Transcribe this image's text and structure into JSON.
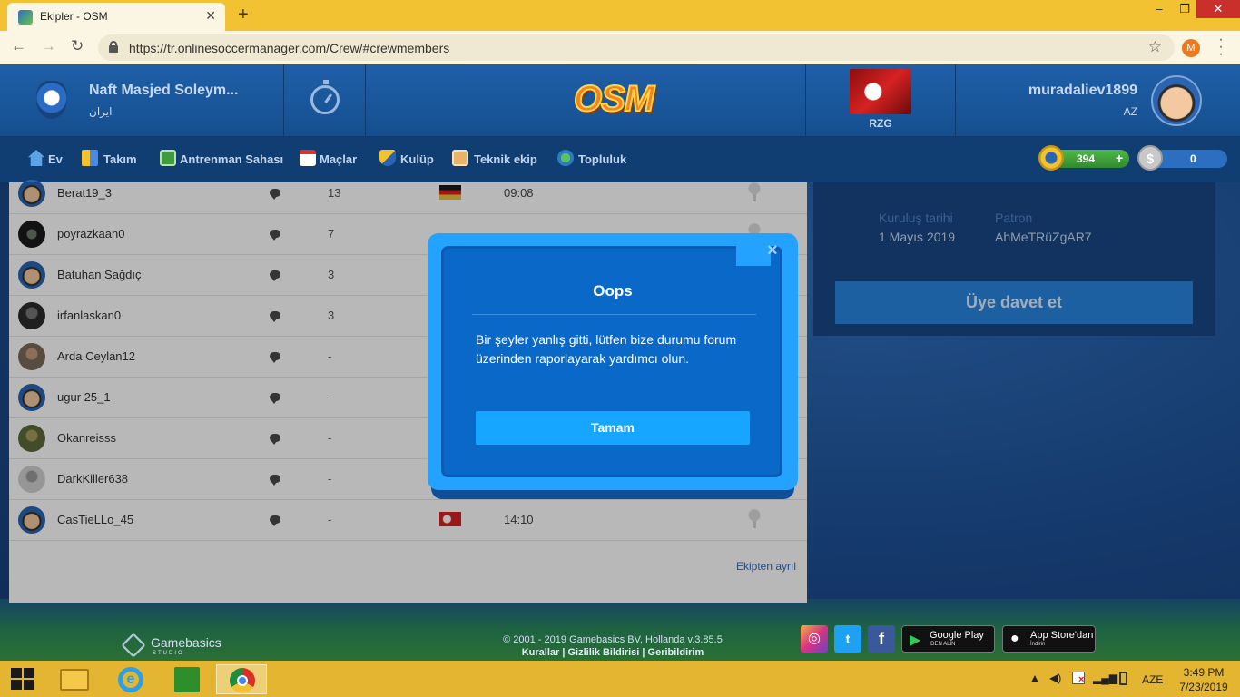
{
  "browser": {
    "tab_title": "Ekipler - OSM",
    "tab_close": "✕",
    "new_tab": "+",
    "url": "https://tr.onlinesoccermanager.com/Crew/#crewmembers",
    "profile_initial": "M",
    "window_min": "–",
    "window_max": "❐",
    "window_close": "✕"
  },
  "header": {
    "club_name": "Naft Masjed Soleym...",
    "club_country": "ایران",
    "logo_text": "OSM",
    "crew_tag": "RZG",
    "manager_name": "muradaliev1899",
    "manager_country": "AZ"
  },
  "nav": {
    "items": [
      "Ev",
      "Takım",
      "Antrenman Sahası",
      "Maçlar",
      "Kulüp",
      "Teknik ekip",
      "Topluluk"
    ],
    "coins": "394",
    "coin_plus": "+",
    "cash": "0",
    "cash_symbol": "$"
  },
  "members": [
    {
      "name": "Berat19_3",
      "count": "13",
      "flag": "de",
      "time": "09:08",
      "avatar": "osm"
    },
    {
      "name": "poyrazkaan0",
      "count": "7",
      "flag": "",
      "time": "",
      "avatar": "dark"
    },
    {
      "name": "Batuhan Sağdıç",
      "count": "3",
      "flag": "",
      "time": "",
      "avatar": "osm"
    },
    {
      "name": "irfanlaskan0",
      "count": "3",
      "flag": "",
      "time": "",
      "avatar": "grey"
    },
    {
      "name": "Arda Ceylan12",
      "count": "-",
      "flag": "",
      "time": "",
      "avatar": "photo"
    },
    {
      "name": "ugur 25_1",
      "count": "-",
      "flag": "",
      "time": "",
      "avatar": "osm"
    },
    {
      "name": "Okanreisss",
      "count": "-",
      "flag": "",
      "time": "",
      "avatar": "green"
    },
    {
      "name": "DarkKiller638",
      "count": "-",
      "flag": "",
      "time": "",
      "avatar": "light"
    },
    {
      "name": "CasTieLLo_45",
      "count": "-",
      "flag": "tr",
      "time": "14:10",
      "avatar": "osm"
    }
  ],
  "leave_crew": "Ekipten ayrıl",
  "crew_info": {
    "founded_label": "Kuruluş tarihi",
    "founded_value": "1 Mayıs 2019",
    "owner_label": "Patron",
    "owner_value": "AhMeTRüZgAR7",
    "invite_button": "Üye davet et"
  },
  "modal": {
    "title": "Oops",
    "message": "Bir şeyler yanlış gitti, lütfen bize durumu forum üzerinden raporlayarak yardımcı olun.",
    "ok_button": "Tamam",
    "close": "×"
  },
  "footer": {
    "brand": "Gamebasics",
    "brand_sub": "STUDIO",
    "copyright": "© 2001 - 2019 Gamebasics BV, Hollanda v.3.85.5",
    "links": "Kurallar  |  Gizlilik Bildirisi  |  Geribildirim",
    "twitter": "t",
    "facebook": "f",
    "gplay_title": "Google Play",
    "gplay_sub": "'DEN ALIN",
    "apple_title": "App Store'dan",
    "apple_sub": "İndirin"
  },
  "taskbar": {
    "language": "AZE",
    "time": "3:49 PM",
    "date": "7/23/2019"
  },
  "colors": {
    "accent": "#23a3ff",
    "header_blue": "#1f5fa8",
    "taskbar": "#e3b530",
    "tabbar": "#f2c233"
  }
}
